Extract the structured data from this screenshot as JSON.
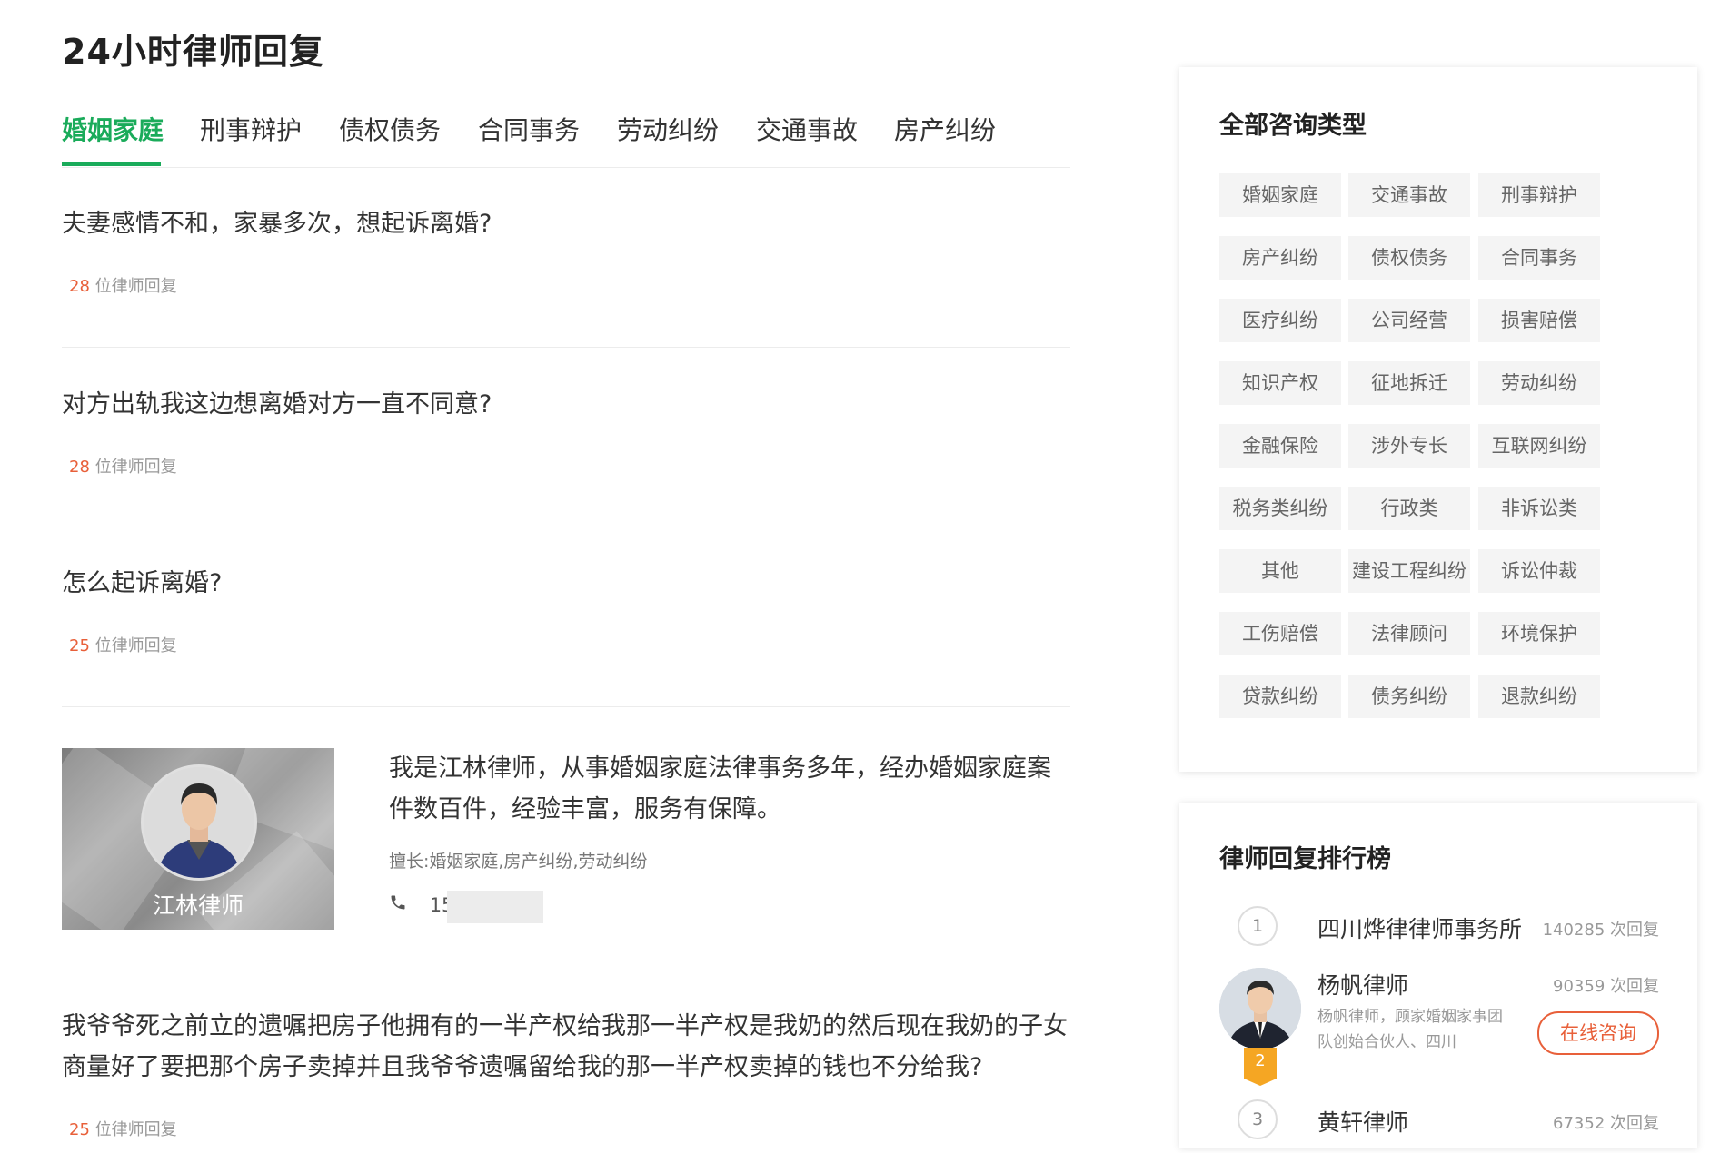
{
  "page_title": "24小时律师回复",
  "tabs": [
    "婚姻家庭",
    "刑事辩护",
    "债权债务",
    "合同事务",
    "劳动纠纷",
    "交通事故",
    "房产纠纷"
  ],
  "questions": [
    {
      "title": "夫妻感情不和，家暴多次，想起诉离婚?",
      "count": "28",
      "suffix": "位律师回复"
    },
    {
      "title": "对方出轨我这边想离婚对方一直不同意?",
      "count": "28",
      "suffix": "位律师回复"
    },
    {
      "title": "怎么起诉离婚?",
      "count": "25",
      "suffix": "位律师回复"
    },
    {
      "title": "我爷爷死之前立的遗嘱把房子他拥有的一半产权给我那一半产权是我奶的然后现在我奶的子女商量好了要把那个房子卖掉并且我爷爷遗嘱留给我的那一半产权卖掉的钱也不分给我?",
      "count": "25",
      "suffix": "位律师回复"
    }
  ],
  "lawyer_ad": {
    "name": "江林律师",
    "intro": "我是江林律师，从事婚姻家庭法律事务多年，经办婚姻家庭案件数百件，经验丰富，服务有保障。",
    "specialty": "擅长:婚姻家庭,房产纠纷,劳动纠纷",
    "phone": "15"
  },
  "categories": {
    "title": "全部咨询类型",
    "items": [
      "婚姻家庭",
      "交通事故",
      "刑事辩护",
      "房产纠纷",
      "债权债务",
      "合同事务",
      "医疗纠纷",
      "公司经营",
      "损害赔偿",
      "知识产权",
      "征地拆迁",
      "劳动纠纷",
      "金融保险",
      "涉外专长",
      "互联网纠纷",
      "税务类纠纷",
      "行政类",
      "非诉讼类",
      "其他",
      "建设工程纠纷",
      "诉讼仲裁",
      "工伤赔偿",
      "法律顾问",
      "环境保护",
      "贷款纠纷",
      "债务纠纷",
      "退款纠纷"
    ]
  },
  "ranking": {
    "title": "律师回复排行榜",
    "items": [
      {
        "rank": "1",
        "name": "四川烨律律师事务所",
        "count": "140285 次回复"
      },
      {
        "rank": "2",
        "name": "杨帆律师",
        "count": "90359 次回复",
        "desc": "杨帆律师，顾家婚姻家事团队创始合伙人、四川",
        "button": "在线咨询"
      },
      {
        "rank": "3",
        "name": "黄轩律师",
        "count": "67352 次回复"
      }
    ]
  },
  "colors": {
    "accent": "#1aab5a",
    "highlight": "#e8603a"
  }
}
